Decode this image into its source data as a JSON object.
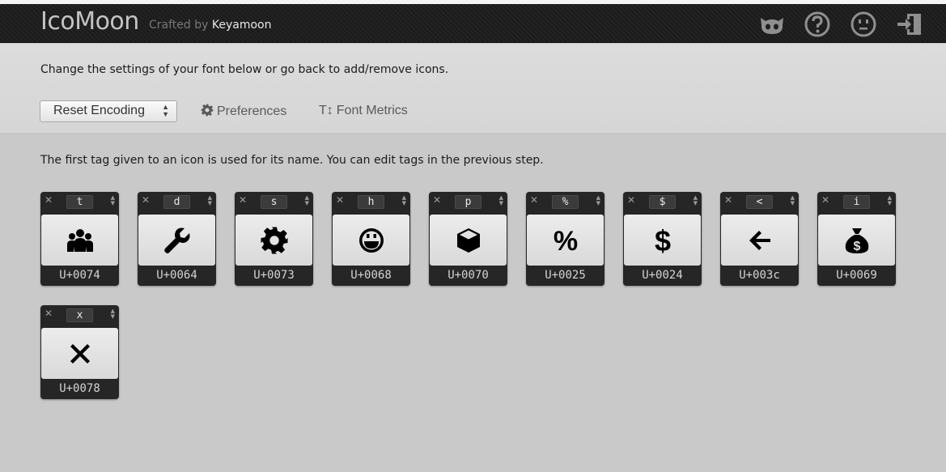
{
  "header": {
    "logo": "IcoMoon",
    "crafted_prefix": "Crafted by",
    "crafted_name": "Keyamoon",
    "icons": [
      "github-icon",
      "help-icon",
      "smiley-icon",
      "exit-icon"
    ]
  },
  "settings": {
    "intro": "Change the settings of your font below or go back to add/remove icons.",
    "encoding_select": "Reset Encoding",
    "preferences": "Preferences",
    "font_metrics": "Font Metrics"
  },
  "note": "The first tag given to an icon is used for its name. You can edit tags in the previous step.",
  "glyphs": [
    {
      "char": "t",
      "code": "U+0074",
      "icon": "users-icon"
    },
    {
      "char": "d",
      "code": "U+0064",
      "icon": "wrench-icon"
    },
    {
      "char": "s",
      "code": "U+0073",
      "icon": "gear-icon"
    },
    {
      "char": "h",
      "code": "U+0068",
      "icon": "happy-face-icon"
    },
    {
      "char": "p",
      "code": "U+0070",
      "icon": "cube-icon"
    },
    {
      "char": "%",
      "code": "U+0025",
      "icon": "percent-icon"
    },
    {
      "char": "$",
      "code": "U+0024",
      "icon": "dollar-icon"
    },
    {
      "char": "<",
      "code": "U+003c",
      "icon": "arrow-left-icon"
    },
    {
      "char": "i",
      "code": "U+0069",
      "icon": "money-bag-icon"
    },
    {
      "char": "x",
      "code": "U+0078",
      "icon": "close-icon"
    }
  ],
  "colors": {
    "header_bg": "#1f1f1f",
    "body_bg": "#c9c9c9",
    "glyph_card": "#262626",
    "glyph_face": "#e2e2e2"
  }
}
